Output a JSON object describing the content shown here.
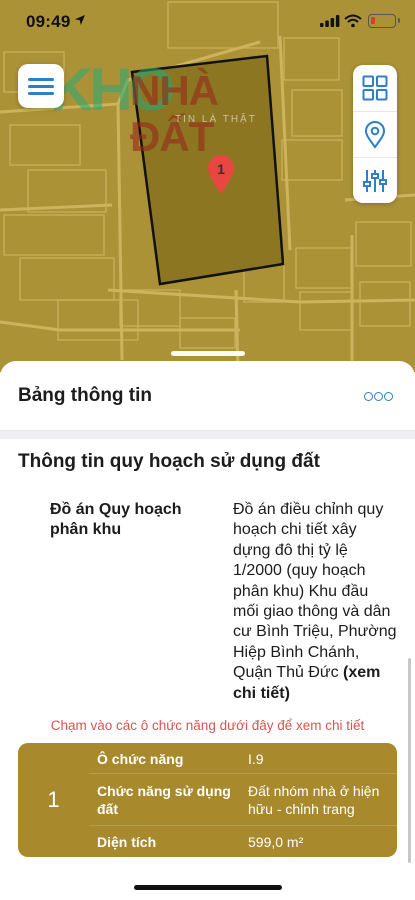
{
  "status_bar": {
    "time": "09:49",
    "battery_color": "#e03a2e"
  },
  "map": {
    "land_color": "#ab9237",
    "parcel_color": "#8c7622",
    "road_color": "#c7ad52",
    "logo": {
      "mark": "KHO",
      "name": "NHÀ ĐẤT",
      "tagline": "TIN LÀ THẬT"
    },
    "pin_label": "1",
    "pin_color": "#e8473f",
    "icons": [
      "menu-icon",
      "grid-icon",
      "location-icon",
      "sliders-icon"
    ]
  },
  "sheet": {
    "title": "Bảng thông tin",
    "more_icon": "more-icon",
    "section_title": "Thông tin quy hoạch sử dụng đất",
    "info": {
      "label": "Đồ án Quy hoạch phân khu",
      "value": "Đồ án điều chỉnh quy hoạch chi tiết xây dựng đô thị tỷ lệ 1/2000 (quy hoạch phân khu) Khu đầu mối giao thông và dân cư Bình Triệu, Phường Hiệp Bình Chánh, Quận Thủ Đức",
      "link": "(xem chi tiết)"
    },
    "hint": "Chạm vào các ô chức năng dưới đây để xem chi tiết",
    "hint_color": "#d9534f",
    "table_color": "#a8892b",
    "function_table": {
      "index": "1",
      "rows": [
        {
          "key": "Ô chức năng",
          "value": "I.9"
        },
        {
          "key": "Chức năng sử dụng đất",
          "value": "Đất nhóm nhà ở hiện hữu - chỉnh trang"
        },
        {
          "key": "Diện tích",
          "value": "599,0 m²"
        }
      ]
    }
  }
}
